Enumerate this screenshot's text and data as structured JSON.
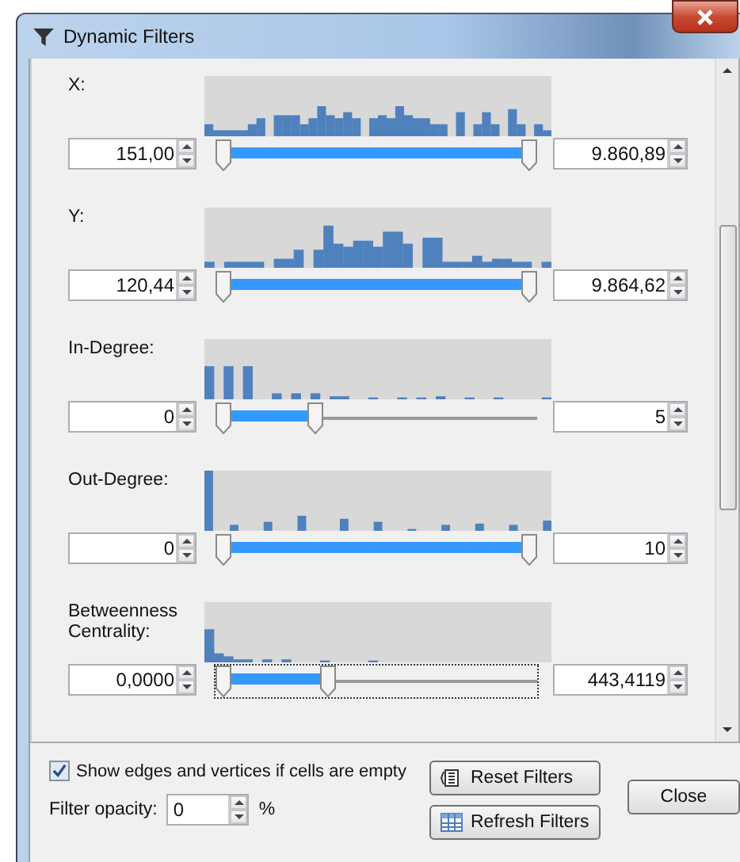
{
  "window": {
    "title": "Dynamic Filters"
  },
  "filters": [
    {
      "label": "X:",
      "min": "151,00",
      "max": "9.860,89",
      "level": 1,
      "focused": false
    },
    {
      "label": "Y:",
      "min": "120,44",
      "max": "9.864,62",
      "level": 1,
      "focused": false
    },
    {
      "label": "In-Degree:",
      "min": "0",
      "max": "5",
      "level": 0.3,
      "focused": false
    },
    {
      "label": "Out-Degree:",
      "min": "0",
      "max": "10",
      "level": 1,
      "focused": false
    },
    {
      "label": "Betweenness Centrality:",
      "min": "0,0000",
      "max": "443,4119",
      "level": 0.34,
      "focused": true
    }
  ],
  "show_empty": {
    "label": "Show edges and vertices if cells are empty",
    "checked": true
  },
  "opacity": {
    "label": "Filter opacity:",
    "value": "0",
    "unit": "%"
  },
  "buttons": [
    {
      "kind": "reset",
      "label": "Reset Filters"
    },
    {
      "kind": "refresh",
      "label": "Refresh Filters"
    },
    {
      "kind": "close",
      "label": "Close"
    }
  ]
}
